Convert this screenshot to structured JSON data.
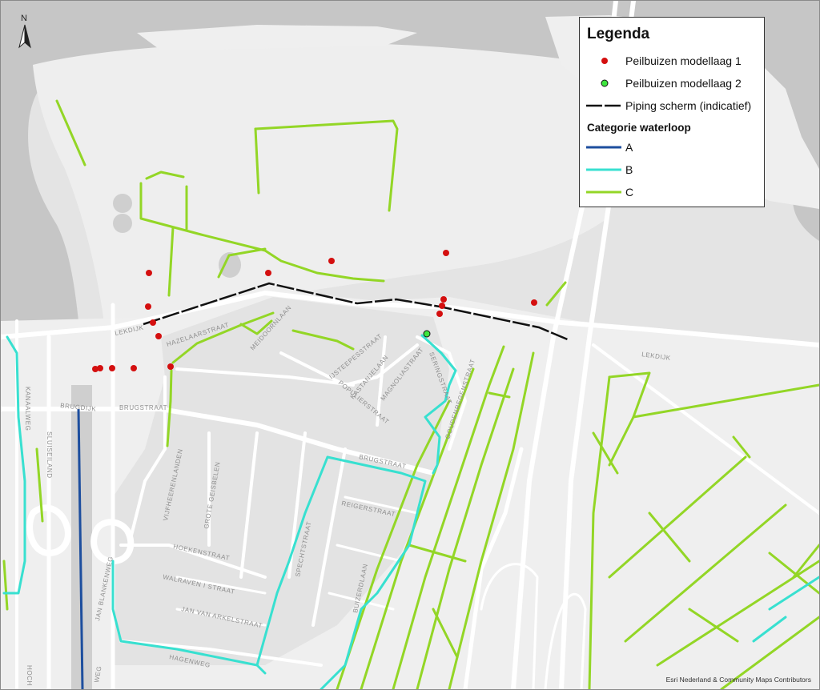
{
  "legend": {
    "title": "Legenda",
    "items": [
      {
        "label": "Peilbuizen modellaag 1",
        "symbol": "dot",
        "color": "#d40f0f"
      },
      {
        "label": "Peilbuizen modellaag 2",
        "symbol": "dot",
        "color": "#3ee63e"
      },
      {
        "label": "Piping scherm (indicatief)",
        "symbol": "dashed-line",
        "color": "#111111"
      }
    ],
    "category_title": "Categorie waterloop",
    "categories": [
      {
        "label": "A",
        "color": "#1d4e9e"
      },
      {
        "label": "B",
        "color": "#38e0d0"
      },
      {
        "label": "C",
        "color": "#93d626"
      }
    ]
  },
  "north_arrow": {
    "label": "N"
  },
  "credit": "Esri Nederland & Community Maps Contributors",
  "streets": {
    "lekdijk_w": "LEKDIJK",
    "lekdijk_e": "LEKDIJK",
    "hazelaarstraat": "HAZELAARSTRAAT",
    "meidoornlaan": "MEIDOORNLAAN",
    "iepenstraat": "IJSTEEPESSTRAAT",
    "kastanjelaan": "KASTANJELAAN",
    "populierstraat": "POPULIERSTRAAT",
    "magnoliastraat": "MAGNOLIASTRAAT",
    "seringstraat": "SERINGSTRAAT",
    "goudenregenstraat": "GOUDENREGENSTRAAT",
    "brugdijk": "BRUGDIJK",
    "brugstraat_w": "BRUGSTRAAT",
    "brugstraat_e": "BRUGSTRAAT",
    "kanaalweg": "KANAALWEG",
    "sluiseiland": "SLUISEILAND",
    "vijfheerenlanden": "VIJFHEERENLANDEN",
    "grote_geisbelen": "GROTE GEISBELEN",
    "hoekenstraat": "HOEKENSTRAAT",
    "walraven": "WALRAVEN I STRAAT",
    "jan_van_arkel": "JAN VAN ARKELSTRAAT",
    "jan_blankenweg": "JAN BLANKENWEG",
    "spechtstraat": "SPECHTSTRAAT",
    "reigerstraat": "REIGERSTRAAT",
    "buizerdlaan": "BUIZERDLAAN",
    "hagenweg": "HAGENWEG",
    "weg_fragment": "WEG",
    "hoch_fragment": "HOCH"
  }
}
